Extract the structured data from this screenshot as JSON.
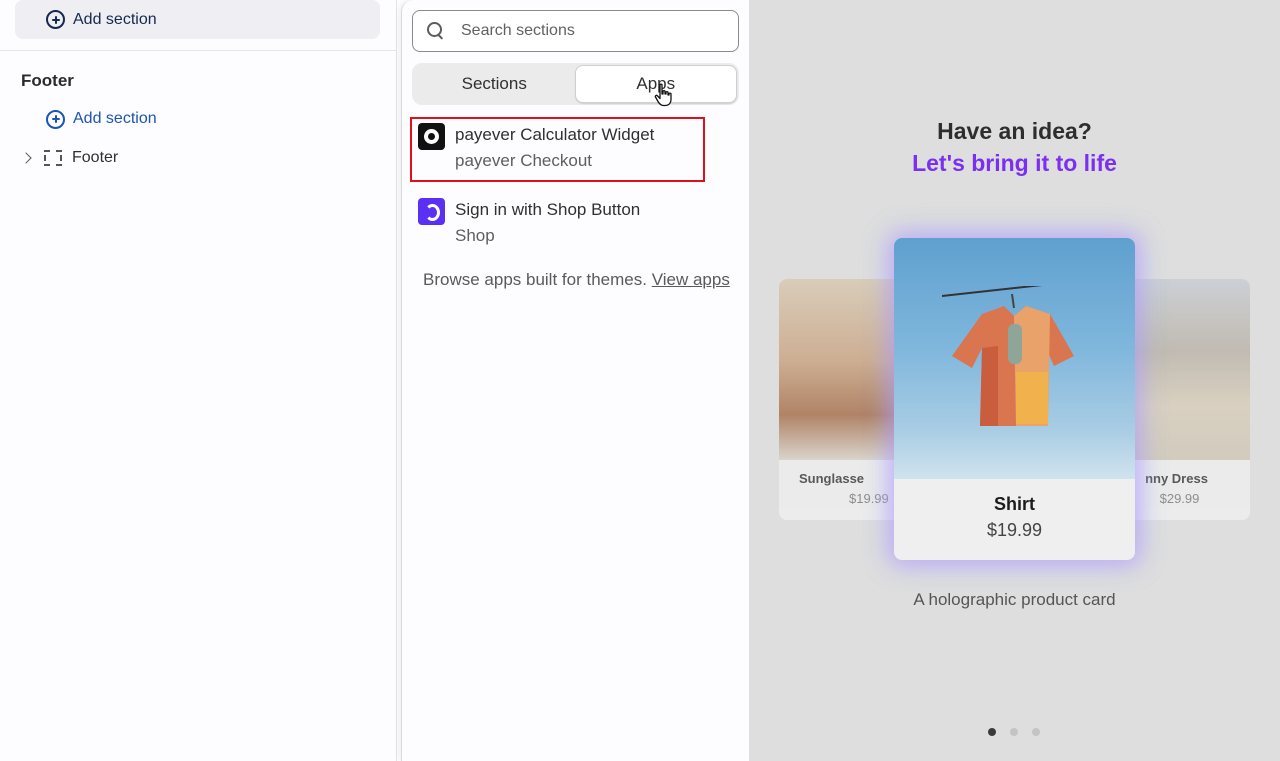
{
  "sidebar": {
    "top_add_section_label": "Add section",
    "footer_group_title": "Footer",
    "footer_add_section_label": "Add section",
    "footer_tree_item_label": "Footer"
  },
  "panel": {
    "search": {
      "placeholder": "Search sections",
      "value": ""
    },
    "tabs": [
      {
        "label": "Sections",
        "active": false
      },
      {
        "label": "Apps",
        "active": true
      }
    ],
    "apps": [
      {
        "name": "payever Calculator Widget",
        "vendor": "payever Checkout",
        "icon": "payever-icon",
        "highlighted": true
      },
      {
        "name": "Sign in with Shop Button",
        "vendor": "Shop",
        "icon": "shop-icon",
        "highlighted": false
      }
    ],
    "browse_text": "Browse apps built for themes.",
    "browse_link": "View apps",
    "highlight_color": "#e0101a"
  },
  "preview": {
    "headline": "Have an idea?",
    "subheadline": "Let's bring it to life",
    "accent_color": "#7b2ff0",
    "cards": [
      {
        "name": "Sunglasse",
        "price": "$19.99"
      },
      {
        "name": "Shirt",
        "price": "$19.99"
      },
      {
        "name": "nny Dress",
        "price": "$29.99"
      }
    ],
    "caption": "A holographic product card",
    "carousel": {
      "total": 3,
      "active_index": 0
    }
  }
}
